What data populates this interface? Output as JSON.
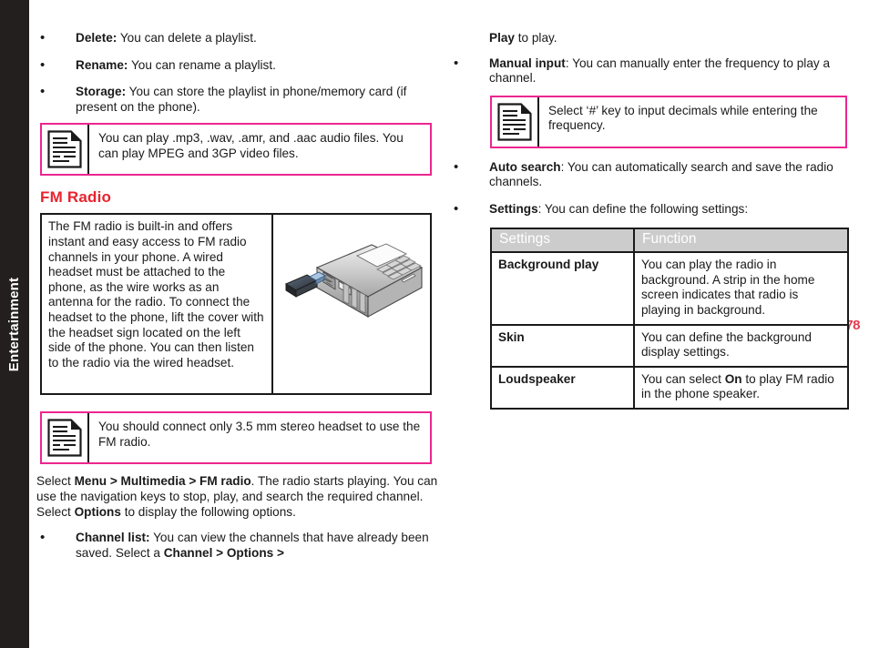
{
  "sidebar": {
    "chapter_label": "Entertainment",
    "background_color": "#231f1f"
  },
  "page_number": "78",
  "colors": {
    "note_border": "#ec268f",
    "heading_red": "#e8232e",
    "page_number": "#e23b4e",
    "table_header_bg": "#cccccc"
  },
  "left_column": {
    "playlist_options": [
      {
        "term": "Delete:",
        "text": " You can delete a playlist."
      },
      {
        "term": "Rename:",
        "text": " You can rename a playlist."
      },
      {
        "term": "Storage:",
        "text": " You can store the playlist in phone/memory card (if present on the phone)."
      }
    ],
    "note_1": {
      "icon": "note-document-icon",
      "text": "You can play .mp3, .wav, .amr, and .aac audio files. You can play MPEG and 3GP video files."
    },
    "section_heading": "FM Radio",
    "info_box": {
      "text": "The FM radio is built-in and offers instant and easy access to FM radio channels in your phone. A wired headset must be attached to the phone, as the wire works as an antenna for the radio. To connect the headset to the phone, lift the cover with the headset sign located on the left side of the phone. You can then listen to the radio via the wired headset.",
      "figure": "phone-with-headset-connector-illustration"
    },
    "note_2": {
      "icon": "note-document-icon",
      "text": "You should connect only 3.5 mm stereo headset to use the FM radio."
    },
    "select_paragraph": {
      "part_1": "Select ",
      "bold_1": "Menu > Multimedia > FM radio",
      "part_2": ". The radio starts playing. You can use the navigation keys to stop, play, and search the required channel. Select ",
      "bold_2": "Options",
      "part_3": " to display the following options."
    },
    "options_bullet": {
      "term": "Channel list:",
      "text_1": " You can view the channels that have already been saved. Select a ",
      "bold_1": "Channel > Options >"
    }
  },
  "right_column": {
    "continuation": {
      "bold_1": "Play",
      "text_1": " to play."
    },
    "bullets_top": [
      {
        "term": "Manual input",
        "text": ": You can manually enter the frequency to play a channel."
      }
    ],
    "note_3": {
      "icon": "note-document-icon",
      "text": "Select ‘#’ key to input decimals while entering the frequency."
    },
    "bullets_bottom": [
      {
        "term": "Auto search",
        "text": ": You can automatically search and save the radio channels."
      },
      {
        "term": "Settings",
        "text": ": You can define the following settings:"
      }
    ],
    "settings_table": {
      "headers": [
        "Settings",
        "Function"
      ],
      "rows": [
        {
          "setting": "Background play",
          "function": "You can play the radio in background. A strip in the home screen indicates that radio is playing in background."
        },
        {
          "setting": "Skin",
          "function_prefix": "You can define the background display settings.",
          "function": "You can define the background display settings."
        },
        {
          "setting": "Loudspeaker",
          "function_part_1": "You can select ",
          "function_bold": "On",
          "function_part_2": " to play FM radio in the phone speaker."
        }
      ]
    }
  }
}
